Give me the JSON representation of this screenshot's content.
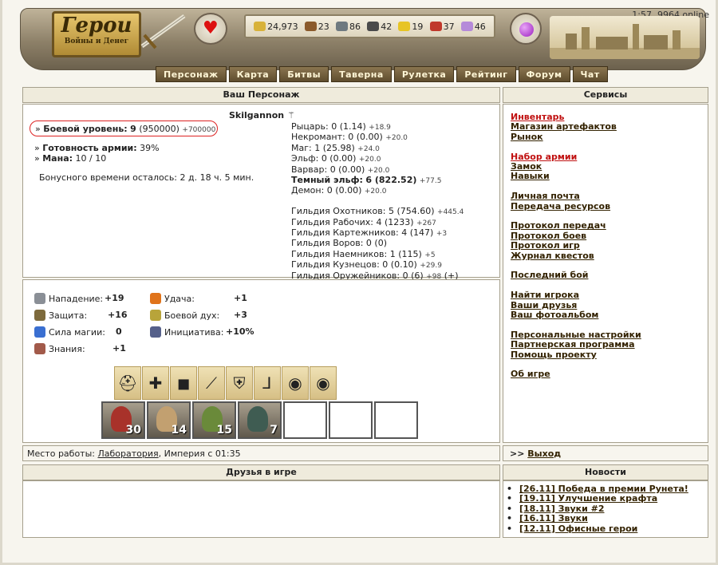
{
  "header": {
    "online": "1:57, 9964 online",
    "logo_main": "Герои",
    "logo_sub": "Войны и Денег",
    "resources": [
      {
        "icon": "gold-icon",
        "value": "24,973",
        "color": "#d8b23a"
      },
      {
        "icon": "wood-icon",
        "value": "23",
        "color": "#8b5a2b"
      },
      {
        "icon": "ore-icon",
        "value": "86",
        "color": "#6f7a80"
      },
      {
        "icon": "mercury-icon",
        "value": "42",
        "color": "#4a4a4a"
      },
      {
        "icon": "sulfur-icon",
        "value": "19",
        "color": "#e7c424"
      },
      {
        "icon": "crystal-icon",
        "value": "37",
        "color": "#c0392b"
      },
      {
        "icon": "gems-icon",
        "value": "46",
        "color": "#b58ad9"
      }
    ],
    "nav": [
      "Персонаж",
      "Карта",
      "Битвы",
      "Таверна",
      "Рулетка",
      "Рейтинг",
      "Форум",
      "Чат"
    ]
  },
  "character": {
    "section_title": "Ваш Персонаж",
    "name": "Skilgannon",
    "level_label": "Боевой уровень:",
    "level_value": "9",
    "level_exp": "(950000)",
    "level_next": "+700000",
    "army_label": "Готовность армии:",
    "army_value": "39%",
    "mana_label": "Мана:",
    "mana_value": "10 / 10",
    "bonus": "Бонусного времени осталось: 2 д. 18 ч. 5 мин.",
    "guild_reset": "(+)",
    "skills": [
      {
        "name": "Рыцарь:",
        "val": "0 (1.14)",
        "plus": "+18.9",
        "bold": false
      },
      {
        "name": "Некромант:",
        "val": "0 (0.00)",
        "plus": "+20.0",
        "bold": false
      },
      {
        "name": "Маг:",
        "val": "1 (25.98)",
        "plus": "+24.0",
        "bold": false
      },
      {
        "name": "Эльф:",
        "val": "0 (0.00)",
        "plus": "+20.0",
        "bold": false
      },
      {
        "name": "Варвар:",
        "val": "0 (0.00)",
        "plus": "+20.0",
        "bold": false
      },
      {
        "name": "Темный эльф:",
        "val": "6 (822.52)",
        "plus": "+77.5",
        "bold": true
      },
      {
        "name": "Демон:",
        "val": "0 (0.00)",
        "plus": "+20.0",
        "bold": false
      }
    ],
    "guilds": [
      {
        "name": "Гильдия Охотников:",
        "val": "5 (754.60)",
        "plus": "+445.4"
      },
      {
        "name": "Гильдия Рабочих:",
        "val": "4 (1233)",
        "plus": "+267"
      },
      {
        "name": "Гильдия Картежников:",
        "val": "4 (147)",
        "plus": "+3"
      },
      {
        "name": "Гильдия Воров:",
        "val": "0 (0)",
        "plus": ""
      },
      {
        "name": "Гильдия Наемников:",
        "val": "1 (115)",
        "plus": "+5"
      },
      {
        "name": "Гильдия Кузнецов:",
        "val": "0 (0.10)",
        "plus": "+29.9"
      },
      {
        "name": "Гильдия Оружейников:",
        "val": "0 (6)",
        "plus": "+98"
      }
    ],
    "stats": [
      {
        "icon": "sword-icon",
        "label": "Нападение:",
        "value": "+19",
        "color": "#8a8f96"
      },
      {
        "icon": "shield-icon",
        "label": "Защита:",
        "value": "+16",
        "color": "#7d6a3c"
      },
      {
        "icon": "magic-wand-icon",
        "label": "Сила магии:",
        "value": "0",
        "color": "#3a6fd1"
      },
      {
        "icon": "book-icon",
        "label": "Знания:",
        "value": "+1",
        "color": "#a25a4a"
      },
      {
        "icon": "rainbow-icon",
        "label": "Удача:",
        "value": "+1",
        "color": "#e0731a"
      },
      {
        "icon": "wings-icon",
        "label": "Боевой дух:",
        "value": "+3",
        "color": "#b8a43a"
      },
      {
        "icon": "flask-icon",
        "label": "Инициатива:",
        "value": "+10%",
        "color": "#55608a"
      }
    ],
    "equipment": [
      {
        "icon": "helmet-icon",
        "glyph": "⛑"
      },
      {
        "icon": "amulet-icon",
        "glyph": "✚"
      },
      {
        "icon": "armor-icon",
        "glyph": "◼"
      },
      {
        "icon": "weapon-icon",
        "glyph": "⟋"
      },
      {
        "icon": "shield-item-icon",
        "glyph": "⛨"
      },
      {
        "icon": "boots-icon",
        "glyph": "⅃"
      },
      {
        "icon": "ring-icon",
        "glyph": "◉"
      },
      {
        "icon": "ring-icon",
        "glyph": "◉"
      }
    ],
    "army": [
      {
        "count": "30",
        "color": "#a8322a"
      },
      {
        "count": "14",
        "color": "#c2a070"
      },
      {
        "count": "15",
        "color": "#6a8a3a"
      },
      {
        "count": "7",
        "color": "#3f5c52"
      },
      {
        "count": "",
        "color": ""
      },
      {
        "count": "",
        "color": ""
      },
      {
        "count": "",
        "color": ""
      }
    ],
    "workplace_label": "Место работы:",
    "workplace_link": "Лаборатория",
    "workplace_rest": ", Империя с 01:35"
  },
  "services": {
    "title": "Сервисы",
    "groups": [
      [
        {
          "label": "Инвентарь",
          "red": true
        },
        {
          "label": "Магазин артефактов"
        },
        {
          "label": "Рынок"
        }
      ],
      [
        {
          "label": "Набор армии",
          "red": true
        },
        {
          "label": "Замок"
        },
        {
          "label": "Навыки"
        }
      ],
      [
        {
          "label": "Личная почта"
        },
        {
          "label": "Передача ресурсов"
        }
      ],
      [
        {
          "label": "Протокол передач"
        },
        {
          "label": "Протокол боев"
        },
        {
          "label": "Протокол игр"
        },
        {
          "label": "Журнал квестов"
        }
      ],
      [
        {
          "label": "Последний бой"
        }
      ],
      [
        {
          "label": "Найти игрока"
        },
        {
          "label": "Ваши друзья"
        },
        {
          "label": "Ваш фотоальбом"
        }
      ],
      [
        {
          "label": "Персональные настройки"
        },
        {
          "label": "Партнерская программа"
        },
        {
          "label": "Помощь проекту"
        }
      ],
      [
        {
          "label": "Об игре"
        }
      ]
    ],
    "exit_prefix": ">>",
    "exit_label": "Выход"
  },
  "friends": {
    "title": "Друзья в игре"
  },
  "news": {
    "title": "Новости",
    "items": [
      "[26.11] Победа в премии Рунета!",
      "[19.11] Улучшение крафта",
      "[18.11] Звуки #2",
      "[16.11] Звуки",
      "[12.11] Офисные герои"
    ]
  }
}
